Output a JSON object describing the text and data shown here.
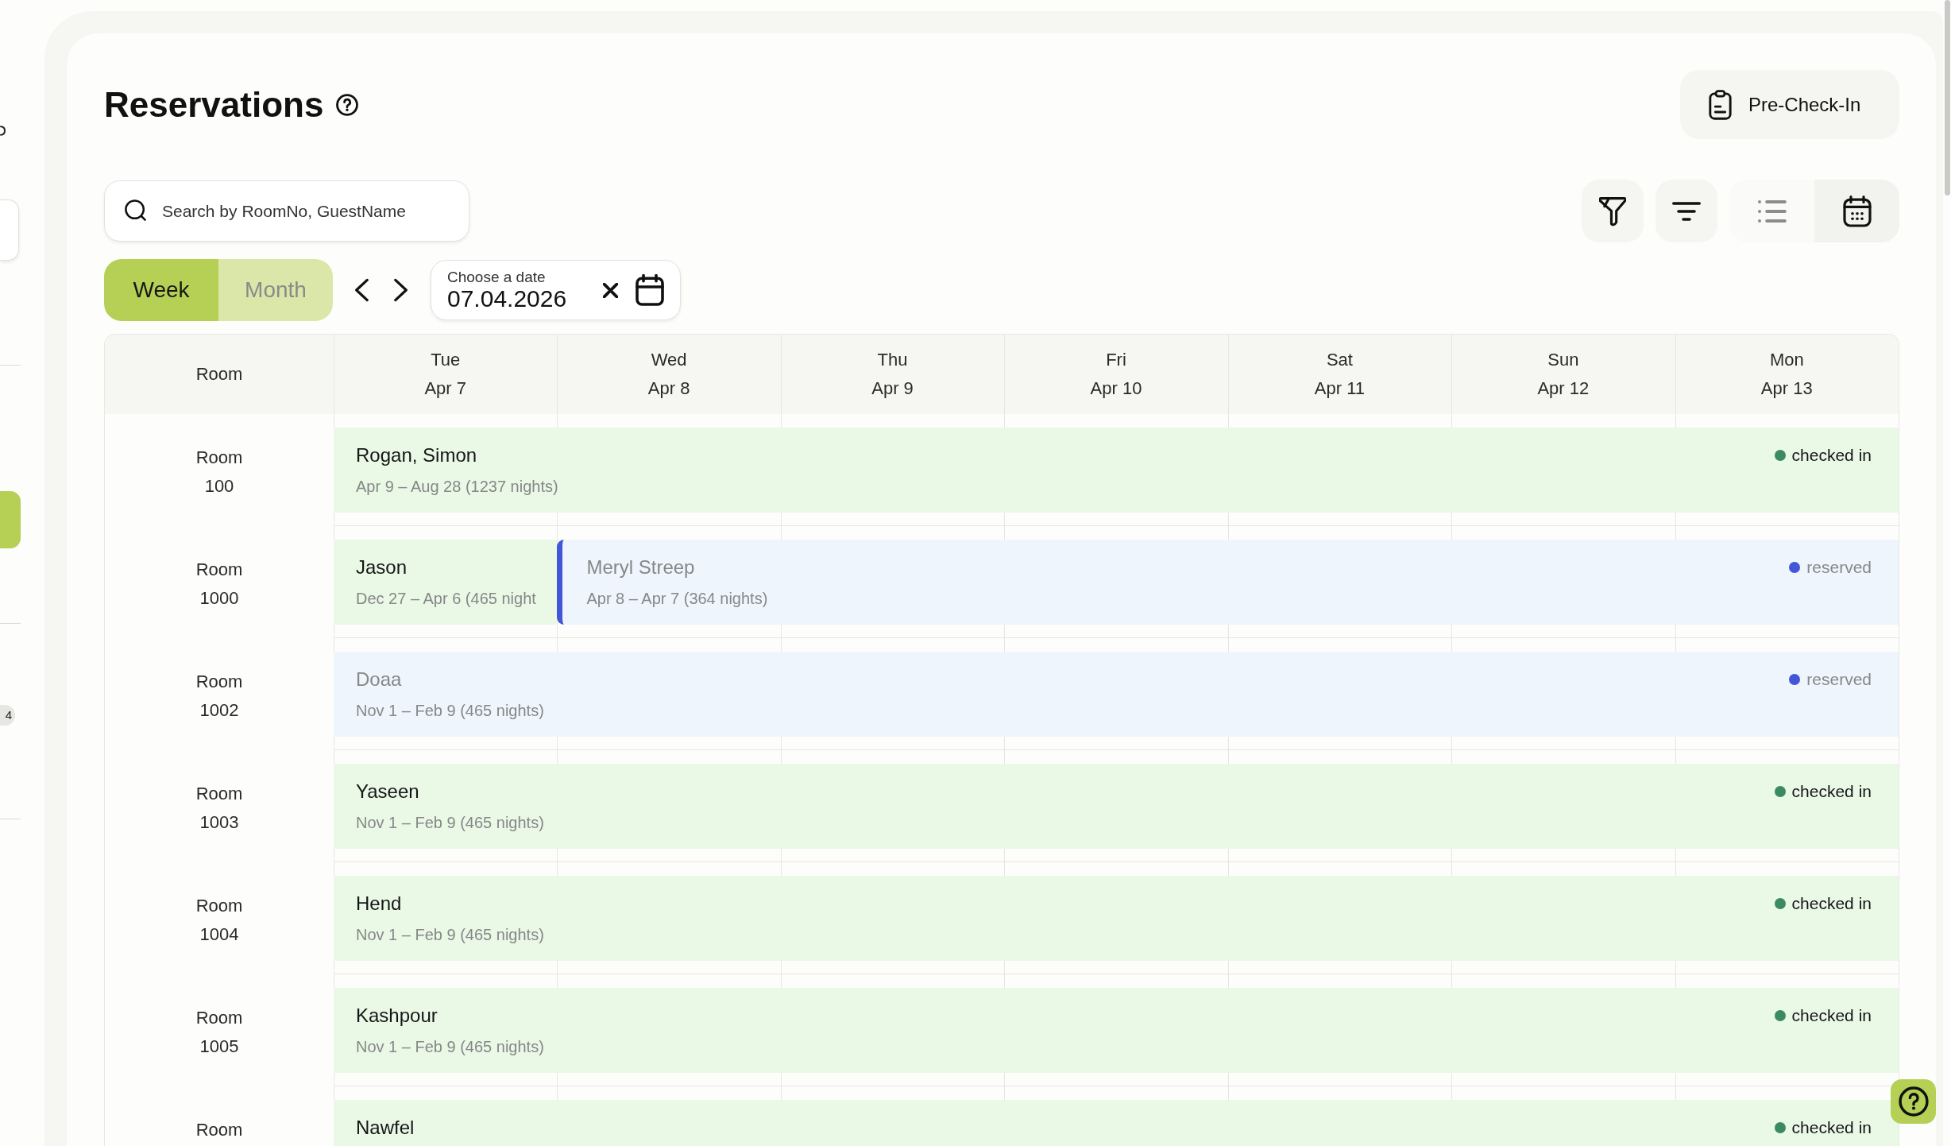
{
  "sidebar": {
    "badge": "4"
  },
  "page": {
    "title": "Reservations",
    "action": {
      "label": "Pre-Check-In"
    }
  },
  "search": {
    "placeholder": "Search by RoomNo, GuestName"
  },
  "view_modes": [
    {
      "kind": "list",
      "selected": false
    },
    {
      "kind": "calendar",
      "selected": true
    }
  ],
  "range_tabs": [
    {
      "label": "Week",
      "selected": true
    },
    {
      "label": "Month",
      "selected": false
    }
  ],
  "date_picker": {
    "label": "Choose a date",
    "value": "07.04.2026"
  },
  "table": {
    "room_header": "Room",
    "days": [
      {
        "weekday": "Tue",
        "date": "Apr 7"
      },
      {
        "weekday": "Wed",
        "date": "Apr 8"
      },
      {
        "weekday": "Thu",
        "date": "Apr 9"
      },
      {
        "weekday": "Fri",
        "date": "Apr 10"
      },
      {
        "weekday": "Sat",
        "date": "Apr 11"
      },
      {
        "weekday": "Sun",
        "date": "Apr 12"
      },
      {
        "weekday": "Mon",
        "date": "Apr 13"
      }
    ],
    "rows": [
      {
        "room_label": "Room",
        "room_number": "100",
        "bookings": [
          {
            "kind": "checked_in",
            "guest": "Rogan, Simon",
            "dates": "Apr 9 – Aug 28 (1237 nights)",
            "status": "checked in",
            "color": "#3b8a63",
            "marker": false
          }
        ]
      },
      {
        "room_label": "Room",
        "room_number": "1000",
        "bookings": [
          {
            "kind": "checked_in",
            "guest": "Jason",
            "dates": "Dec 27 – Apr 6 (465 night",
            "marker": false
          },
          {
            "kind": "reserved",
            "guest": "Meryl Streep",
            "dates": "Apr 8 – Apr 7 (364 nights)",
            "status": "reserved",
            "color": "#4257d8",
            "marker": true
          }
        ]
      },
      {
        "room_label": "Room",
        "room_number": "1002",
        "bookings": [
          {
            "kind": "reserved",
            "guest": "Doaa",
            "dates": "Nov 1 – Feb 9 (465 nights)",
            "status": "reserved",
            "color": "#4257d8",
            "marker": false
          }
        ]
      },
      {
        "room_label": "Room",
        "room_number": "1003",
        "bookings": [
          {
            "kind": "checked_in",
            "guest": "Yaseen",
            "dates": "Nov 1 – Feb 9 (465 nights)",
            "status": "checked in",
            "color": "#3b8a63",
            "marker": false
          }
        ]
      },
      {
        "room_label": "Room",
        "room_number": "1004",
        "bookings": [
          {
            "kind": "checked_in",
            "guest": "Hend",
            "dates": "Nov 1 – Feb 9 (465 nights)",
            "status": "checked in",
            "color": "#3b8a63",
            "marker": false
          }
        ]
      },
      {
        "room_label": "Room",
        "room_number": "1005",
        "bookings": [
          {
            "kind": "checked_in",
            "guest": "Kashpour",
            "dates": "Nov 1 – Feb 9 (465 nights)",
            "status": "checked in",
            "color": "#3b8a63",
            "marker": false
          }
        ]
      },
      {
        "room_label": "Room",
        "bookings": [
          {
            "kind": "checked_in",
            "guest": "Nawfel",
            "status": "checked in",
            "color": "#3b8a63",
            "marker": false
          }
        ]
      }
    ]
  }
}
